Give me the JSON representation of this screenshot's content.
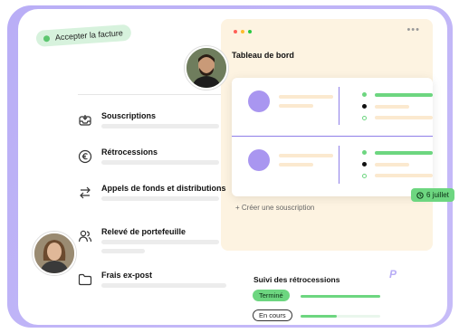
{
  "accept_pill": {
    "label": "Accepter la facture"
  },
  "dashboard": {
    "title": "Tableau de bord",
    "window_dots": [
      "#ff5f57",
      "#febc2e",
      "#28c840"
    ],
    "ellipsis": "•••",
    "create_link": "+ Créer une souscription"
  },
  "date_badge": {
    "label": "6 juillet"
  },
  "menu": {
    "items": [
      {
        "label": "Souscriptions",
        "icon": "inbox-icon"
      },
      {
        "label": "Rétrocessions",
        "icon": "euro-icon"
      },
      {
        "label": "Appels de fonds et distributions",
        "icon": "transfer-icon"
      },
      {
        "label": "Relevé de portefeuille",
        "icon": "users-icon"
      },
      {
        "label": "Frais ex-post",
        "icon": "folder-icon"
      }
    ]
  },
  "suivi": {
    "title": "Suivi des rétrocessions",
    "statuses": [
      {
        "label": "Terminé",
        "progress": 1.0
      },
      {
        "label": "En cours",
        "progress": 0.45
      }
    ]
  },
  "brand": {
    "mark": "P"
  },
  "colors": {
    "frame": "#b9aef6",
    "panel": "#fdf3e1",
    "accent_green": "#6dd680",
    "accent_purple": "#a996f0"
  }
}
